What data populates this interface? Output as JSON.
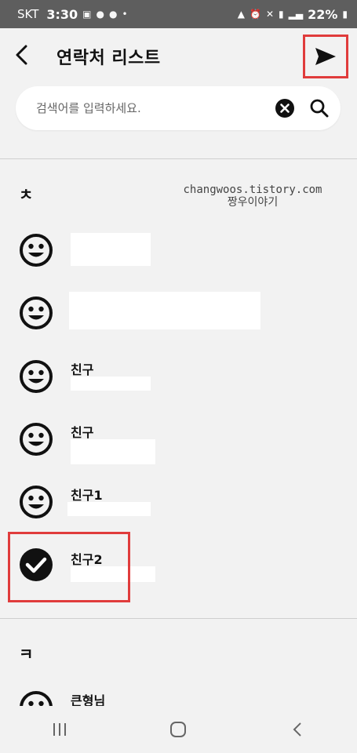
{
  "status_bar": {
    "carrier": "SKT",
    "time": "3:30",
    "battery": "22%"
  },
  "header": {
    "title": "연락처 리스트"
  },
  "search": {
    "placeholder": "검색어를 입력하세요."
  },
  "watermark": {
    "line1": "changwoos.tistory.com",
    "line2": "짱우이야기"
  },
  "sections": [
    {
      "header": "ㅊ"
    },
    {
      "header": "ㅋ"
    }
  ],
  "contacts": [
    {
      "name": "",
      "selected": false
    },
    {
      "name": "",
      "selected": false
    },
    {
      "name": "친구",
      "selected": false
    },
    {
      "name": "친구",
      "selected": false
    },
    {
      "name": "친구1",
      "selected": false
    },
    {
      "name": "친구2",
      "selected": true
    },
    {
      "name": "큰형님",
      "selected": false
    }
  ],
  "colors": {
    "highlight": "#e03c3c",
    "status_bar": "#5e5e5e",
    "background": "#f2f2f2"
  }
}
